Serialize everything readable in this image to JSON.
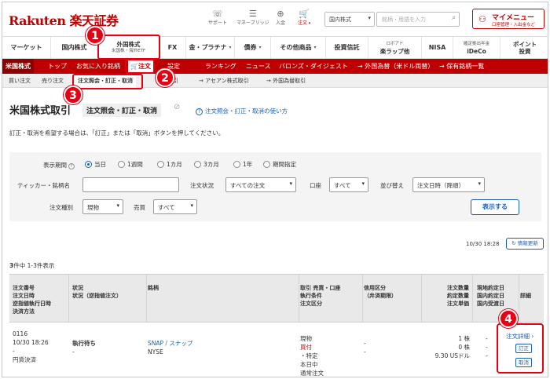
{
  "header": {
    "logo": "Rakuten 楽天証券",
    "icons": [
      {
        "label": "サポート",
        "icon": "headset-icon"
      },
      {
        "label": "マネーブリッジ",
        "icon": "bridge-icon"
      },
      {
        "label": "入金",
        "icon": "deposit-icon"
      },
      {
        "label": "注文",
        "icon": "cart-icon"
      }
    ],
    "search_select": "国内株式",
    "search_placeholder": "銘柄・用語を入力",
    "my_menu_title": "マイメニュー",
    "my_menu_sub": "口座管理・入出金など"
  },
  "main_nav": [
    {
      "label": "マーケット"
    },
    {
      "label": "国内株式"
    },
    {
      "label": "外国株式",
      "sub": "米国株・海外ETF"
    },
    {
      "label": "FX"
    },
    {
      "label": "金・プラチナ"
    },
    {
      "label": "債券"
    },
    {
      "label": "その他商品"
    },
    {
      "label": "投資信託"
    },
    {
      "label": "ロボアド",
      "sub": "楽ラップ他"
    },
    {
      "label": "NISA"
    },
    {
      "label": "確定拠出年金",
      "sub": "iDeCo"
    },
    {
      "label": "ポイント",
      "sub": "投資"
    }
  ],
  "sub_nav": {
    "current": "米国株式",
    "items": [
      "トップ",
      "お気に入り銘柄",
      "注文",
      "設定",
      "ランキング",
      "ニュース",
      "バロンズ・ダイジェスト",
      "→ 外国為替（米ドル両替）",
      "→ 保有銘柄一覧"
    ]
  },
  "tertiary_nav": {
    "items": [
      "買い注文",
      "売り注文",
      "注文照会・訂正・取消",
      "取引",
      "→ アセアン株式取引",
      "→ 外国為替取引"
    ]
  },
  "page": {
    "title": "米国株式取引",
    "subtitle": "注文照会・訂正・取消",
    "help_link": "注文照会・訂正・取消の使い方",
    "note": "訂正・取消を希望する場合は、「訂正」または「取消」ボタンを押してください。"
  },
  "filter": {
    "period_label": "表示期間",
    "period_options": [
      "当日",
      "1週間",
      "1カ月",
      "3カ月",
      "1年",
      "期間指定"
    ],
    "period_selected": "当日",
    "ticker_label": "ティッカー・銘柄名",
    "status_label": "注文状況",
    "status_value": "すべての注文",
    "account_label": "口座",
    "account_value": "すべて",
    "sort_label": "並び替え",
    "sort_value": "注文日時（降順）",
    "type_label": "注文種別",
    "type_value": "現物",
    "trade_label": "売買",
    "trade_value": "すべて",
    "show_button": "表示する"
  },
  "list": {
    "timestamp": "10/30 18:28",
    "refresh_label": "情報更新",
    "count_bold": "3",
    "count_text": "件中 1-3件表示"
  },
  "table": {
    "headers": [
      [
        "注文番号",
        "注文日時",
        "逆指値執行日時",
        "決済方法"
      ],
      [
        "状況",
        "状況（逆指値注文）"
      ],
      [
        "銘柄"
      ],
      [
        "取引 売買・口座",
        "執行条件",
        "注文区分"
      ],
      [
        "信用区分",
        "（弁済期限）"
      ],
      [
        "注文数量",
        "約定数量",
        "注文単価"
      ],
      [
        "現地約定日",
        "国内約定日",
        "国内受渡日"
      ],
      [
        "詳細"
      ]
    ],
    "rows": [
      {
        "order_no": "0116",
        "order_time": "10/30 18:26",
        "stop_time": "-",
        "settlement": "円貨決済",
        "status": "執行待ち",
        "status_stop": "-",
        "symbol": "SNAP / スナップ",
        "market": "NYSE",
        "trade_prefix": "現物 ",
        "trade_side": "買付",
        "trade_suffix": "・特定",
        "condition": "本日中",
        "order_type": "通常注文",
        "margin": "-",
        "margin_due": "-",
        "qty": "1 株",
        "filled": "0 株",
        "price": "9.30 USドル",
        "local_date": "-",
        "dom_date": "-",
        "dom_settle": "-",
        "detail_link": "注文詳細",
        "modify_button": "訂正",
        "cancel_button": "取消"
      }
    ]
  },
  "annotations": [
    "1",
    "2",
    "3",
    "4"
  ]
}
